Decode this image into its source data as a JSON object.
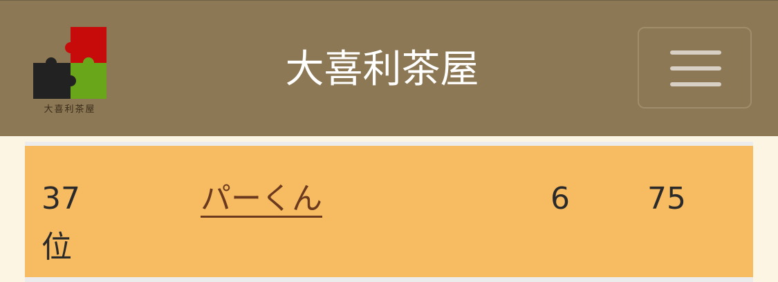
{
  "header": {
    "logo_text": "大喜利茶屋",
    "title": "大喜利茶屋",
    "menu_icon": "hamburger-menu-icon"
  },
  "colors": {
    "header_bg": "#8c7854",
    "row_bg": "#f7bb62",
    "page_bg": "#fdf5e4",
    "link": "#6b3a1e",
    "logo_red": "#c70b0b",
    "logo_green": "#6aa61a",
    "logo_black": "#222222"
  },
  "ranking": {
    "rows": [
      {
        "rank": "37位",
        "name": "パーくん",
        "col3": "6",
        "col4": "75"
      }
    ]
  }
}
